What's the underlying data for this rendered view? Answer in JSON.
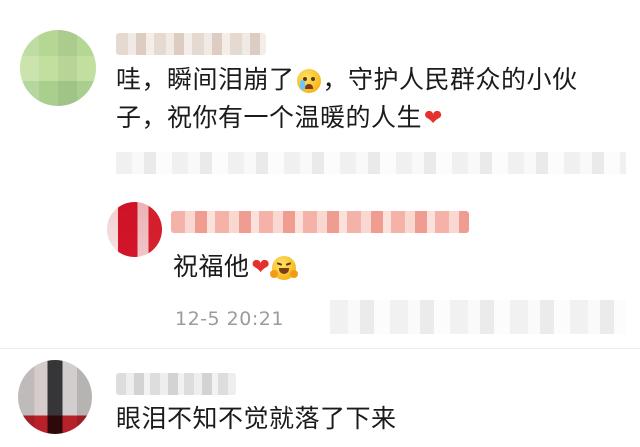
{
  "comments": [
    {
      "text_a": "哇，瞬间泪崩了",
      "emoji_a": "crying-face",
      "text_b": "，守护人民群众的小伙子，祝你有一个温暖的人生",
      "emoji_b": "red-heart"
    },
    {
      "reply": true,
      "text": "祝福他",
      "emoji_a": "red-heart",
      "emoji_b": "hugging-face",
      "timestamp": "12-5 20:21"
    },
    {
      "text": "眼泪不知不觉就落了下来"
    }
  ],
  "colors": {
    "heart": "#e5302c",
    "timestamp": "#9b9b9b",
    "text": "#1b1b1b"
  }
}
